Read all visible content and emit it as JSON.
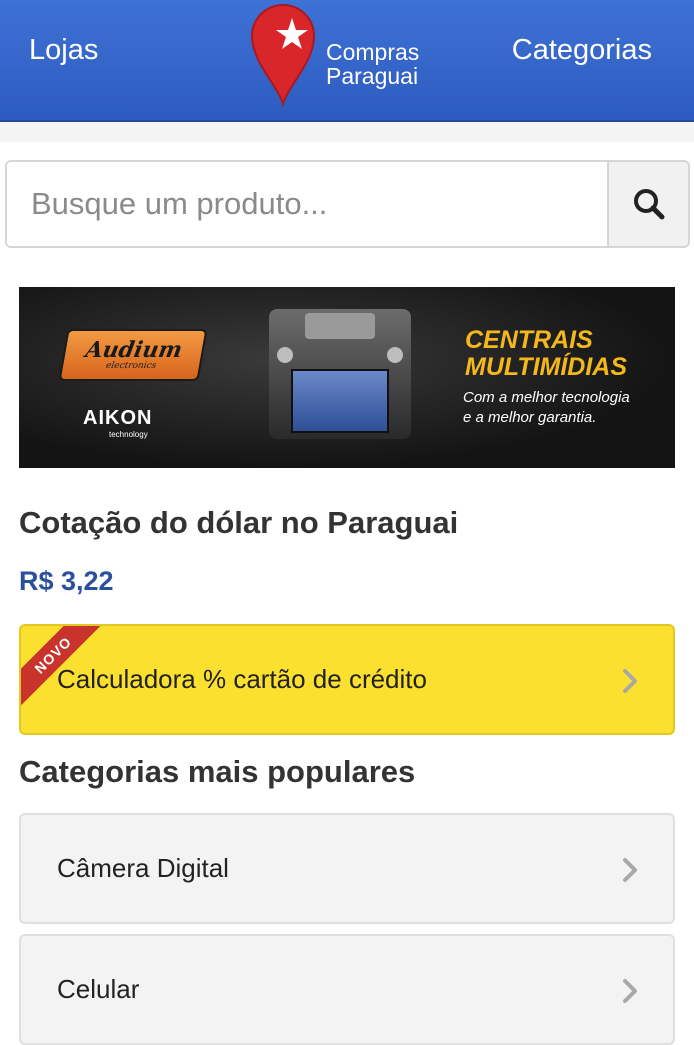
{
  "header": {
    "left_link": "Lojas",
    "right_link": "Categorias",
    "logo_line1": "Compras",
    "logo_line2": "Paraguai",
    "brand_color": "#3a6cd0"
  },
  "search": {
    "placeholder": "Busque um produto...",
    "button_icon": "search-icon"
  },
  "banner": {
    "brand1": "Audium",
    "brand1_sub": "electronics",
    "brand2": "AIKON",
    "brand2_sub": "technology",
    "title_line1": "CENTRAIS",
    "title_line2": "MULTIMÍDIAS",
    "subtitle_line1": "Com a melhor tecnologia",
    "subtitle_line2": "e a melhor garantia."
  },
  "dollar": {
    "title": "Cotação do dólar no Paraguai",
    "value": "R$ 3,22"
  },
  "calculator": {
    "badge": "NOVO",
    "label": "Calculadora % cartão de crédito",
    "icon": "chevron-right-icon",
    "color": "#fbe02f"
  },
  "popular": {
    "title": "Categorias mais populares",
    "items": [
      {
        "label": "Câmera Digital",
        "icon": "chevron-right-icon"
      },
      {
        "label": "Celular",
        "icon": "chevron-right-icon"
      }
    ]
  }
}
